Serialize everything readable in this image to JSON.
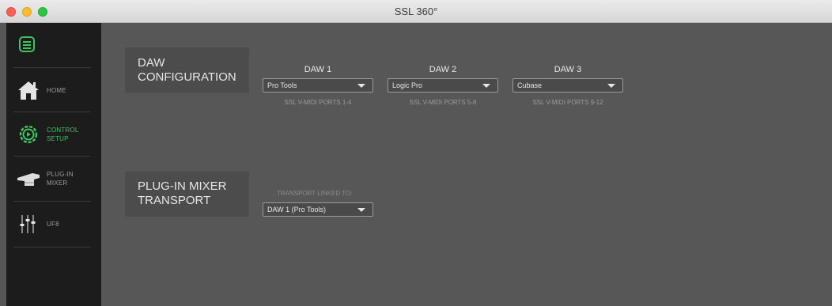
{
  "window": {
    "title": "SSL 360°"
  },
  "sidebar": {
    "menu_icon": "hamburger-menu-icon",
    "items": [
      {
        "label_line1": "HOME",
        "label_line2": "",
        "icon": "home-icon",
        "active": false
      },
      {
        "label_line1": "CONTROL",
        "label_line2": "SETUP",
        "icon": "gear-icon",
        "active": true
      },
      {
        "label_line1": "PLUG-IN",
        "label_line2": "MIXER",
        "icon": "plugin-mixer-icon",
        "active": false
      },
      {
        "label_line1": "UF8",
        "label_line2": "",
        "icon": "faders-icon",
        "active": false
      }
    ]
  },
  "daw_config": {
    "title_line1": "DAW",
    "title_line2": "CONFIGURATION",
    "columns": [
      {
        "heading": "DAW 1",
        "selected": "Pro Tools",
        "ports": "SSL V-MIDI PORTS 1-4"
      },
      {
        "heading": "DAW 2",
        "selected": "Logic Pro",
        "ports": "SSL V-MIDI PORTS 5-8"
      },
      {
        "heading": "DAW 3",
        "selected": "Cubase",
        "ports": "SSL V-MIDI PORTS 9-12"
      }
    ]
  },
  "transport": {
    "title_line1": "PLUG-IN MIXER",
    "title_line2": "TRANSPORT",
    "label": "TRANSPORT LINKED TO:",
    "selected": "DAW 1 (Pro Tools)"
  },
  "colors": {
    "accent": "#3fc45f",
    "sidebar_bg": "#1c1c1c",
    "main_bg": "#575757"
  }
}
